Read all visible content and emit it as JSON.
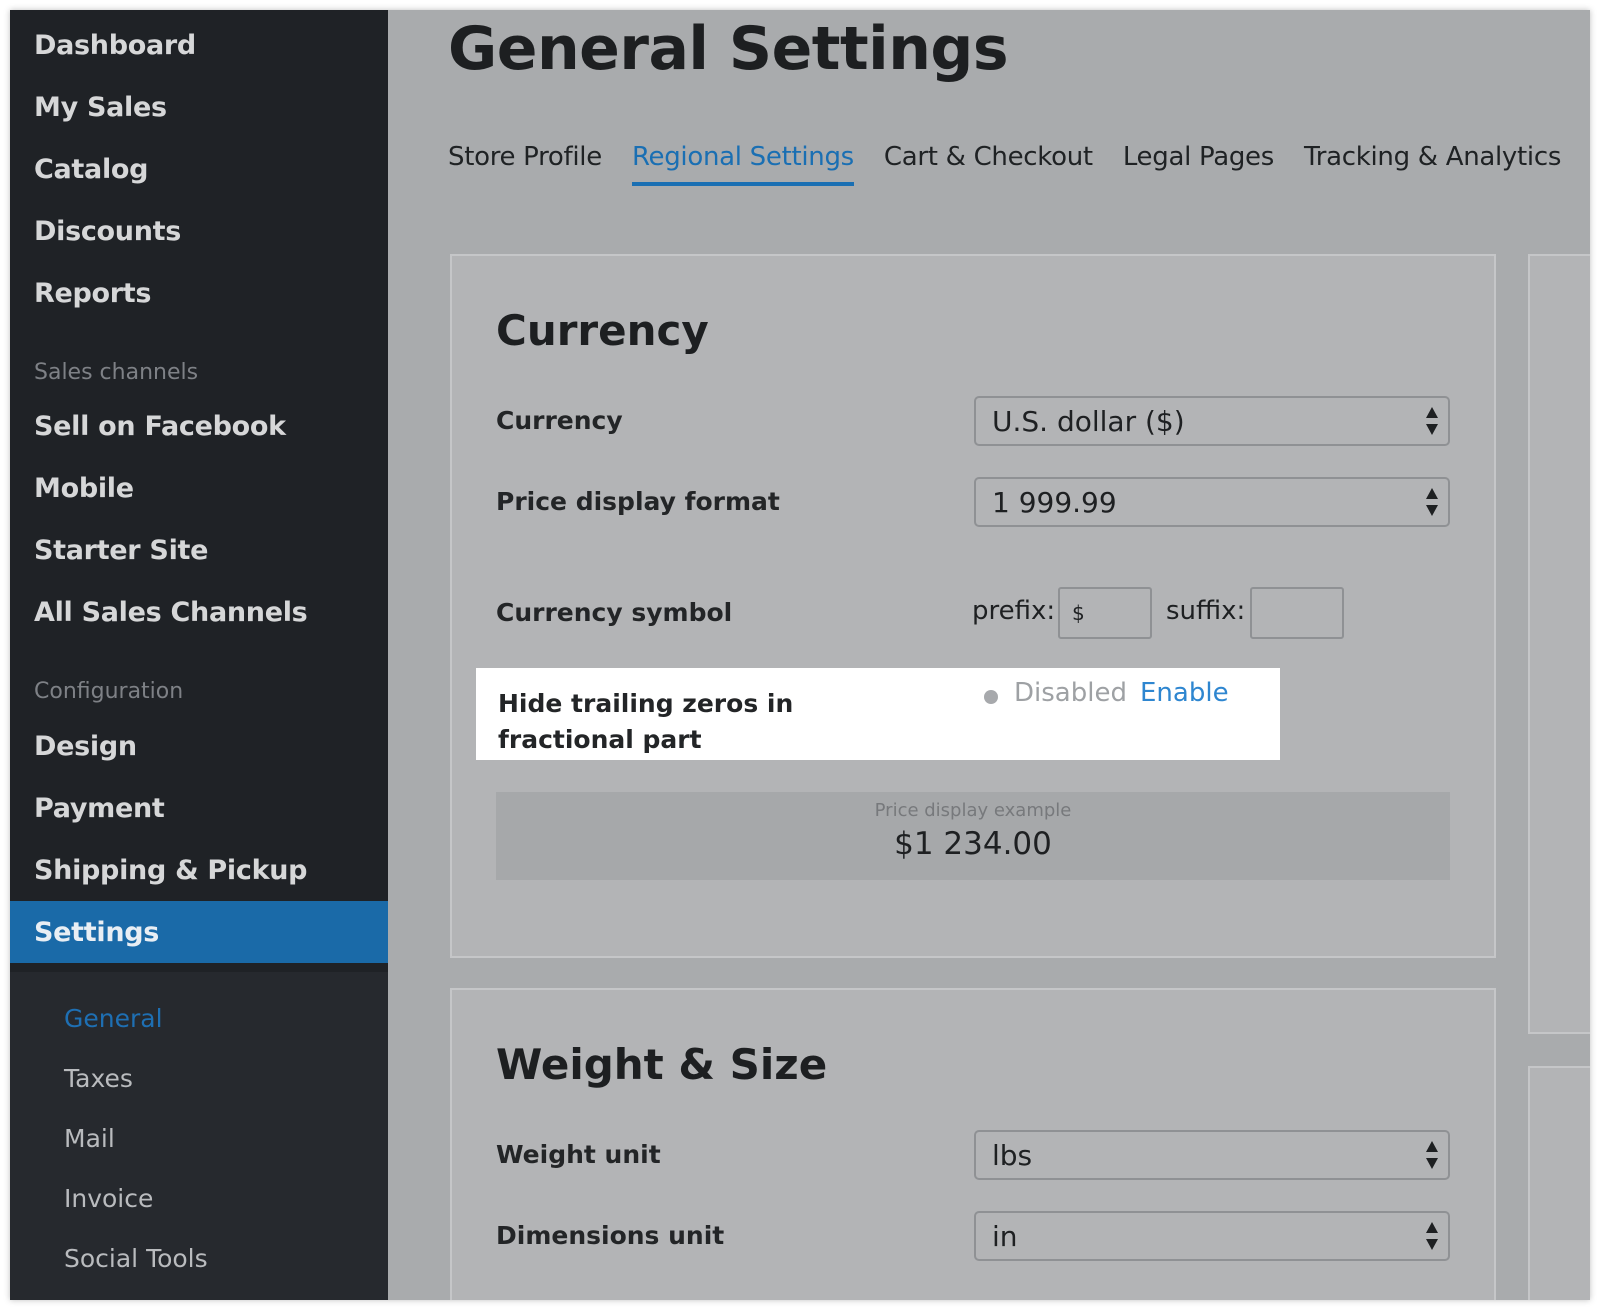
{
  "sidebar": {
    "items": [
      {
        "label": "Dashboard"
      },
      {
        "label": "My Sales"
      },
      {
        "label": "Catalog"
      },
      {
        "label": "Discounts"
      },
      {
        "label": "Reports"
      }
    ],
    "sales_channels_heading": "Sales channels",
    "sales_channels": [
      {
        "label": "Sell on Facebook"
      },
      {
        "label": "Mobile"
      },
      {
        "label": "Starter Site"
      },
      {
        "label": "All Sales Channels"
      }
    ],
    "configuration_heading": "Configuration",
    "configuration": [
      {
        "label": "Design"
      },
      {
        "label": "Payment"
      },
      {
        "label": "Shipping & Pickup"
      },
      {
        "label": "Settings"
      }
    ],
    "settings_sub": [
      {
        "label": "General"
      },
      {
        "label": "Taxes"
      },
      {
        "label": "Mail"
      },
      {
        "label": "Invoice"
      },
      {
        "label": "Social Tools"
      }
    ],
    "active_color": "#1a6aa8"
  },
  "page": {
    "title": "General Settings",
    "tabs": [
      {
        "label": "Store Profile"
      },
      {
        "label": "Regional Settings"
      },
      {
        "label": "Cart & Checkout"
      },
      {
        "label": "Legal Pages"
      },
      {
        "label": "Tracking & Analytics"
      }
    ],
    "active_tab": "Regional Settings"
  },
  "currency": {
    "title": "Currency",
    "currency_label": "Currency",
    "currency_value": "U.S. dollar ($)",
    "format_label": "Price display format",
    "format_value": "1 999.99",
    "symbol_label": "Currency symbol",
    "prefix_label": "prefix:",
    "prefix_value": "$",
    "suffix_label": "suffix:",
    "suffix_value": "",
    "trailing_label": "Hide trailing zeros in fractional part",
    "trailing_status": "Disabled",
    "trailing_action": "Enable",
    "example_label": "Price display example",
    "example_value": "$1 234.00"
  },
  "weight": {
    "title": "Weight & Size",
    "weight_label": "Weight unit",
    "weight_value": "lbs",
    "dimensions_label": "Dimensions unit",
    "dimensions_value": "in"
  },
  "colors": {
    "accent": "#1a6fb3",
    "link": "#2e86d0"
  }
}
